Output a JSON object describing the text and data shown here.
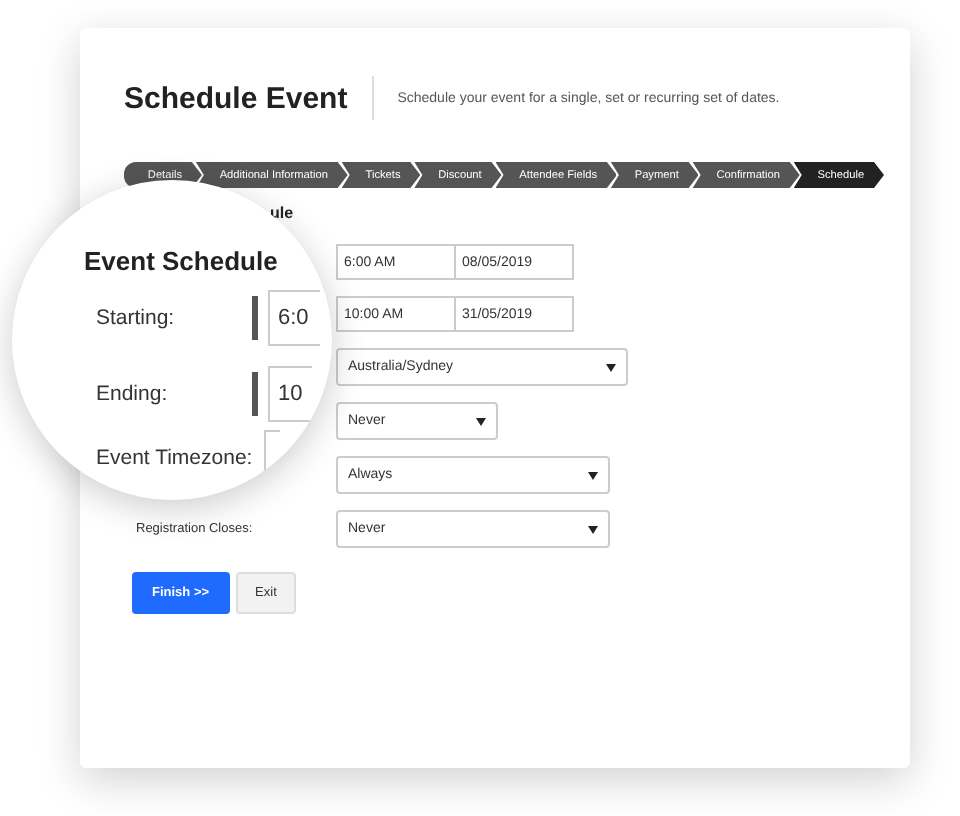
{
  "header": {
    "title": "Schedule Event",
    "subtitle": "Schedule your event for a single, set or recurring set of dates."
  },
  "steps": [
    {
      "label": "Details",
      "selected": false
    },
    {
      "label": "Additional Information",
      "selected": false
    },
    {
      "label": "Tickets",
      "selected": false
    },
    {
      "label": "Discount",
      "selected": false
    },
    {
      "label": "Attendee Fields",
      "selected": false
    },
    {
      "label": "Payment",
      "selected": false
    },
    {
      "label": "Confirmation",
      "selected": false
    },
    {
      "label": "Schedule",
      "selected": true
    }
  ],
  "section_heading": "ule",
  "rows": [
    {
      "kind": "datetime",
      "time": "6:00 AM",
      "date": "08/05/2019"
    },
    {
      "kind": "datetime",
      "time": "10:00 AM",
      "date": "31/05/2019"
    },
    {
      "kind": "select",
      "value": "Australia/Sydney"
    },
    {
      "kind": "select",
      "value": "Never"
    },
    {
      "kind": "select",
      "value": "Always"
    },
    {
      "kind": "select",
      "label": "Registration Closes:",
      "value": "Never"
    }
  ],
  "buttons": [
    {
      "label": "Finish >>",
      "kind": "primary"
    },
    {
      "label": "Exit",
      "kind": "secondary"
    }
  ],
  "magnifier": {
    "heading": "Event Schedule",
    "rows": [
      {
        "label": "Starting:",
        "value": "6:0"
      },
      {
        "label": "Ending:",
        "value": "10"
      },
      {
        "label": "Event Timezone:"
      }
    ]
  }
}
